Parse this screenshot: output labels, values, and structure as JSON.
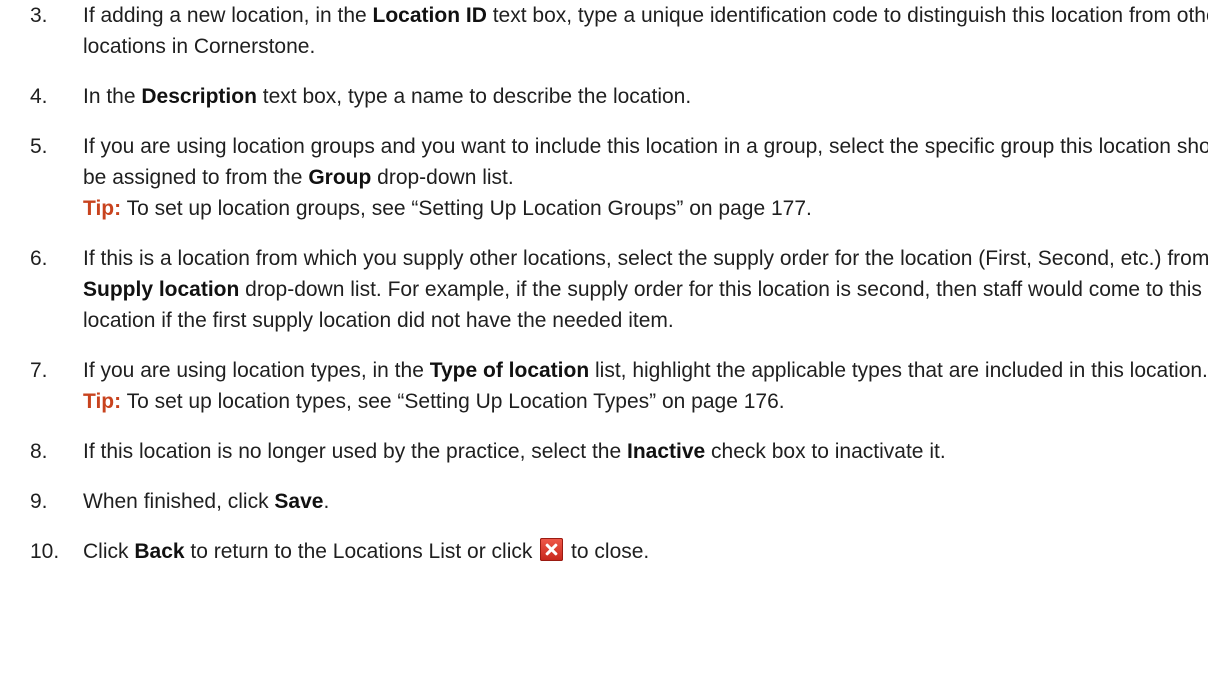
{
  "steps": [
    {
      "number": "3.",
      "parts": [
        "If adding a new location, in the ",
        "Location ID",
        " text box, type a unique identification code to distinguish this location from other locations in Cornerstone."
      ]
    },
    {
      "number": "4.",
      "parts": [
        "In the ",
        "Description",
        " text box, type a name to describe the location."
      ]
    },
    {
      "number": "5.",
      "parts": [
        "If you are using location groups and you want to include this location in a group, select the specific group this location should be assigned to from the ",
        "Group",
        " drop-down list."
      ],
      "tip": {
        "label": "Tip:",
        "text": " To set up location groups, see “Setting Up Location Groups” on page 177."
      }
    },
    {
      "number": "6.",
      "parts": [
        "If this is a location from which you supply other locations, select the supply order for the location (First, Second, etc.) from the ",
        "Supply location",
        " drop-down list. For example, if the supply order for this location is second, then staff would come to this location if the first supply location did not have the needed item."
      ]
    },
    {
      "number": "7.",
      "parts": [
        "If you are using location types, in the ",
        "Type of location",
        " list, highlight the applicable types that are included in this location."
      ],
      "tip": {
        "label": "Tip:",
        "text": " To set up location types, see “Setting Up Location Types” on page 176."
      }
    },
    {
      "number": "8.",
      "parts": [
        "If this location is no longer used by the practice, select the ",
        "Inactive",
        " check box to inactivate it."
      ]
    },
    {
      "number": "9.",
      "parts": [
        "When finished, click ",
        "Save",
        "."
      ]
    },
    {
      "number": "10.",
      "parts": [
        "Click ",
        "Back",
        " to return to the Locations List or click ",
        " to close."
      ],
      "icon": "close-icon"
    }
  ],
  "colors": {
    "tip_label": "#c8431e",
    "close_icon": "#d9362a"
  }
}
